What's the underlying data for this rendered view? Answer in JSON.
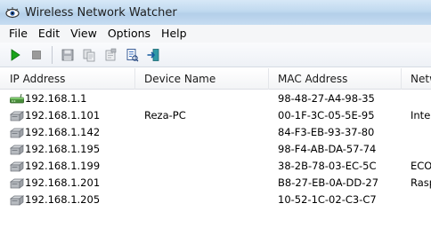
{
  "window": {
    "title": "Wireless Network Watcher",
    "app_icon": "eye-icon"
  },
  "menu": [
    "File",
    "Edit",
    "View",
    "Options",
    "Help"
  ],
  "toolbar": [
    {
      "name": "start-scan-button",
      "icon": "play-icon",
      "color": "#1aa31a"
    },
    {
      "name": "stop-scan-button",
      "icon": "stop-icon",
      "color": "#9a9a9a"
    },
    {
      "name": "save-button",
      "icon": "floppy-disk-icon"
    },
    {
      "name": "copy-button",
      "icon": "copy-icon"
    },
    {
      "name": "properties-button",
      "icon": "properties-icon"
    },
    {
      "name": "html-report-button",
      "icon": "report-icon"
    },
    {
      "name": "exit-button",
      "icon": "exit-icon"
    }
  ],
  "table": {
    "columns": [
      "IP Address",
      "Device Name",
      "MAC Address",
      "Netw"
    ],
    "rows": [
      {
        "ip": "192.168.1.1",
        "name": "",
        "mac": "98-48-27-A4-98-35",
        "vendor": "",
        "icon": "router-icon"
      },
      {
        "ip": "192.168.1.101",
        "name": "Reza-PC",
        "mac": "00-1F-3C-05-5E-95",
        "vendor": "Intel",
        "icon": "computer-icon"
      },
      {
        "ip": "192.168.1.142",
        "name": "",
        "mac": "84-F3-EB-93-37-80",
        "vendor": "",
        "icon": "computer-icon"
      },
      {
        "ip": "192.168.1.195",
        "name": "",
        "mac": "98-F4-AB-DA-57-74",
        "vendor": "",
        "icon": "computer-icon"
      },
      {
        "ip": "192.168.1.199",
        "name": "",
        "mac": "38-2B-78-03-EC-5C",
        "vendor": "ECO",
        "icon": "computer-icon"
      },
      {
        "ip": "192.168.1.201",
        "name": "",
        "mac": "B8-27-EB-0A-DD-27",
        "vendor": "Rasp",
        "icon": "computer-icon"
      },
      {
        "ip": "192.168.1.205",
        "name": "",
        "mac": "10-52-1C-02-C3-C7",
        "vendor": "",
        "icon": "computer-icon"
      }
    ]
  }
}
